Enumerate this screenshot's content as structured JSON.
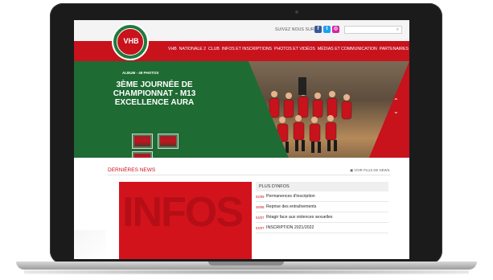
{
  "header": {
    "social_label": "SUIVEZ NOUS SUR",
    "social_icons": [
      {
        "name": "facebook-icon",
        "glyph": "f",
        "color": "#3b5998"
      },
      {
        "name": "twitter-icon",
        "glyph": "t",
        "color": "#1da1f2"
      },
      {
        "name": "instagram-icon",
        "glyph": "◎",
        "color": "#d6249f"
      }
    ],
    "logo_text": "VHB",
    "search_placeholder": "",
    "nav": [
      "VHB",
      "NATIONALE 2",
      "CLUB",
      "INFOS ET INSCRIPTIONS",
      "PHOTOS ET VIDÉOS",
      "MÉDIAS ET COMMUNICATION",
      "PARTENAIRES"
    ]
  },
  "hero": {
    "album_label": "ALBUM - 49 PHOTOS",
    "title": "3ÈME JOURNÉE DE CHAMPIONNAT - M13 EXCELLENCE AURA",
    "arrow_up": "⌃",
    "arrow_down": "⌄"
  },
  "news": {
    "title": "DERNIÈRES NEWS",
    "more_link": "VOIR PLUS DE NEWS",
    "feature_word": "INFOS",
    "plus_title": "PLUS D'INFOS",
    "items": [
      {
        "date": "02/09",
        "label": "Permanences d'inscription"
      },
      {
        "date": "28/08",
        "label": "Reprise des entraînements"
      },
      {
        "date": "04/07",
        "label": "Réagir face aux violences sexuelles"
      },
      {
        "date": "04/07",
        "label": "INSCRIPTION 2021/2022"
      }
    ]
  },
  "colors": {
    "accent": "#c8121c",
    "green": "#1e6b33"
  }
}
